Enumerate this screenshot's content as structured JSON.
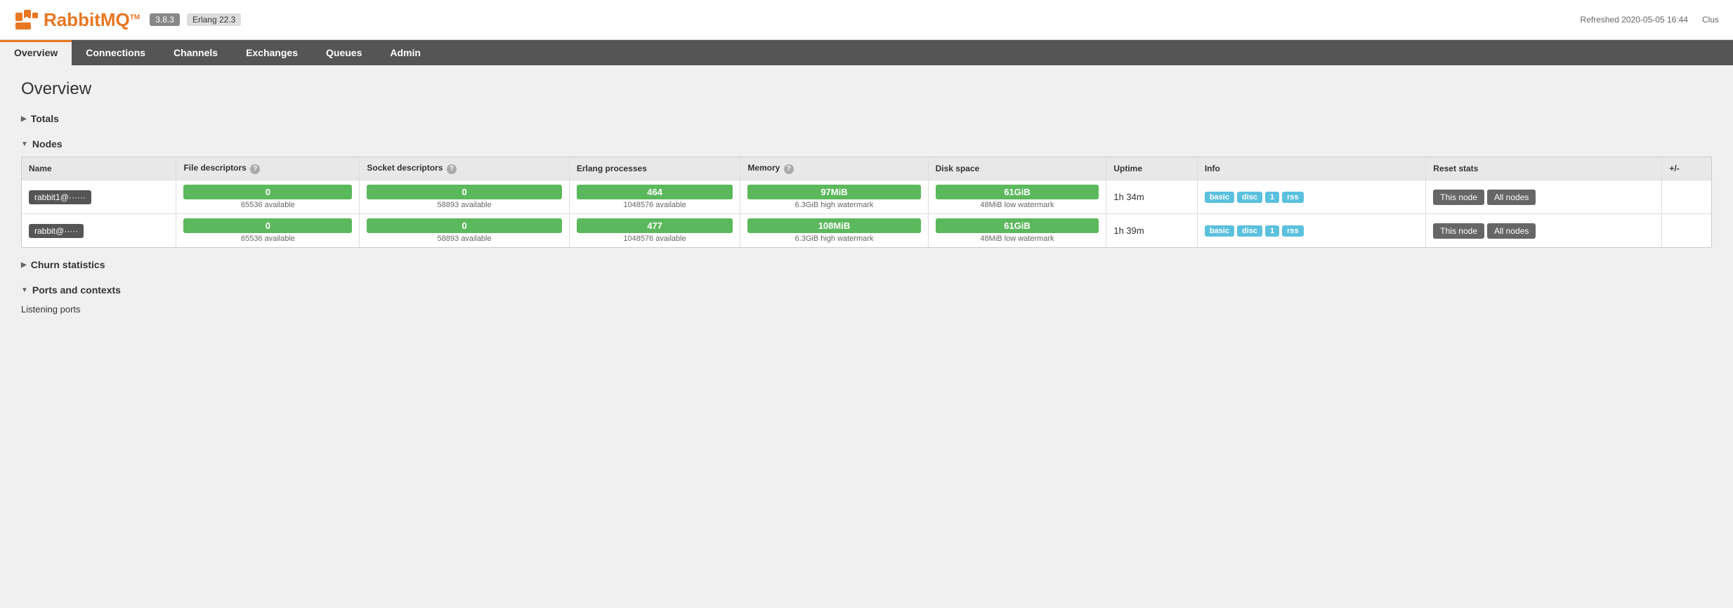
{
  "header": {
    "logo_orange": "Rabbit",
    "logo_dark": "MQ",
    "tm": "TM",
    "version": "3.8.3",
    "erlang": "Erlang 22.3",
    "refresh_label": "Refreshed 2020-05-05 16:44",
    "cluster_label": "Clus"
  },
  "nav": {
    "items": [
      {
        "id": "overview",
        "label": "Overview",
        "active": true
      },
      {
        "id": "connections",
        "label": "Connections",
        "active": false
      },
      {
        "id": "channels",
        "label": "Channels",
        "active": false
      },
      {
        "id": "exchanges",
        "label": "Exchanges",
        "active": false
      },
      {
        "id": "queues",
        "label": "Queues",
        "active": false
      },
      {
        "id": "admin",
        "label": "Admin",
        "active": false
      }
    ]
  },
  "page": {
    "title": "Overview"
  },
  "totals": {
    "label": "Totals",
    "arrow": "▶"
  },
  "nodes": {
    "label": "Nodes",
    "arrow": "▼",
    "plus_minus": "+/-",
    "columns": {
      "name": "Name",
      "file_descriptors": "File descriptors",
      "socket_descriptors": "Socket descriptors",
      "erlang_processes": "Erlang processes",
      "memory": "Memory",
      "disk_space": "Disk space",
      "uptime": "Uptime",
      "info": "Info",
      "reset_stats": "Reset stats"
    },
    "rows": [
      {
        "name": "rabbit1@······",
        "file_desc_value": "0",
        "file_desc_available": "65536 available",
        "socket_desc_value": "0",
        "socket_desc_available": "58893 available",
        "erlang_proc_value": "464",
        "erlang_proc_available": "1048576 available",
        "memory_value": "97MiB",
        "memory_watermark": "6.3GiB high watermark",
        "disk_value": "61GiB",
        "disk_watermark": "48MiB low watermark",
        "uptime": "1h 34m",
        "badges": [
          "basic",
          "disc",
          "1",
          "rss"
        ],
        "btn_this_node": "This node",
        "btn_all_nodes": "All nodes"
      },
      {
        "name": "rabbit@·····",
        "file_desc_value": "0",
        "file_desc_available": "65536 available",
        "socket_desc_value": "0",
        "socket_desc_available": "58893 available",
        "erlang_proc_value": "477",
        "erlang_proc_available": "1048576 available",
        "memory_value": "108MiB",
        "memory_watermark": "6.3GiB high watermark",
        "disk_value": "61GiB",
        "disk_watermark": "48MiB low watermark",
        "uptime": "1h 39m",
        "badges": [
          "basic",
          "disc",
          "1",
          "rss"
        ],
        "btn_this_node": "This node",
        "btn_all_nodes": "All nodes"
      }
    ]
  },
  "churn": {
    "label": "Churn statistics",
    "arrow": "▶"
  },
  "ports": {
    "label": "Ports and contexts",
    "arrow": "▼",
    "listening_ports": "Listening ports"
  },
  "help_symbol": "?"
}
